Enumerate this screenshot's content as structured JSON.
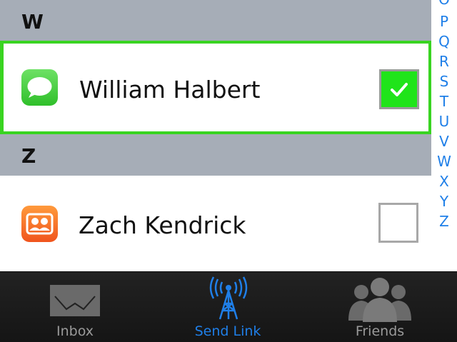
{
  "sections": [
    {
      "letter": "W",
      "contact": {
        "name": "William Halbert",
        "app_icon": "messages-icon",
        "selected": true
      }
    },
    {
      "letter": "Z",
      "contact": {
        "name": "Zach Kendrick",
        "app_icon": "contacts-icon",
        "selected": false
      }
    }
  ],
  "index": [
    "O",
    "P",
    "Q",
    "R",
    "S",
    "T",
    "U",
    "V",
    "W",
    "X",
    "Y",
    "Z"
  ],
  "tabbar": {
    "tabs": [
      {
        "label": "Inbox",
        "icon": "envelope-icon",
        "active": false
      },
      {
        "label": "Send Link",
        "icon": "broadcast-tower-icon",
        "active": true
      },
      {
        "label": "Friends",
        "icon": "friends-icon",
        "active": false
      }
    ]
  },
  "colors": {
    "accent": "#1f7fe8",
    "selection": "#39d421",
    "section_header": "#a6adb7"
  }
}
